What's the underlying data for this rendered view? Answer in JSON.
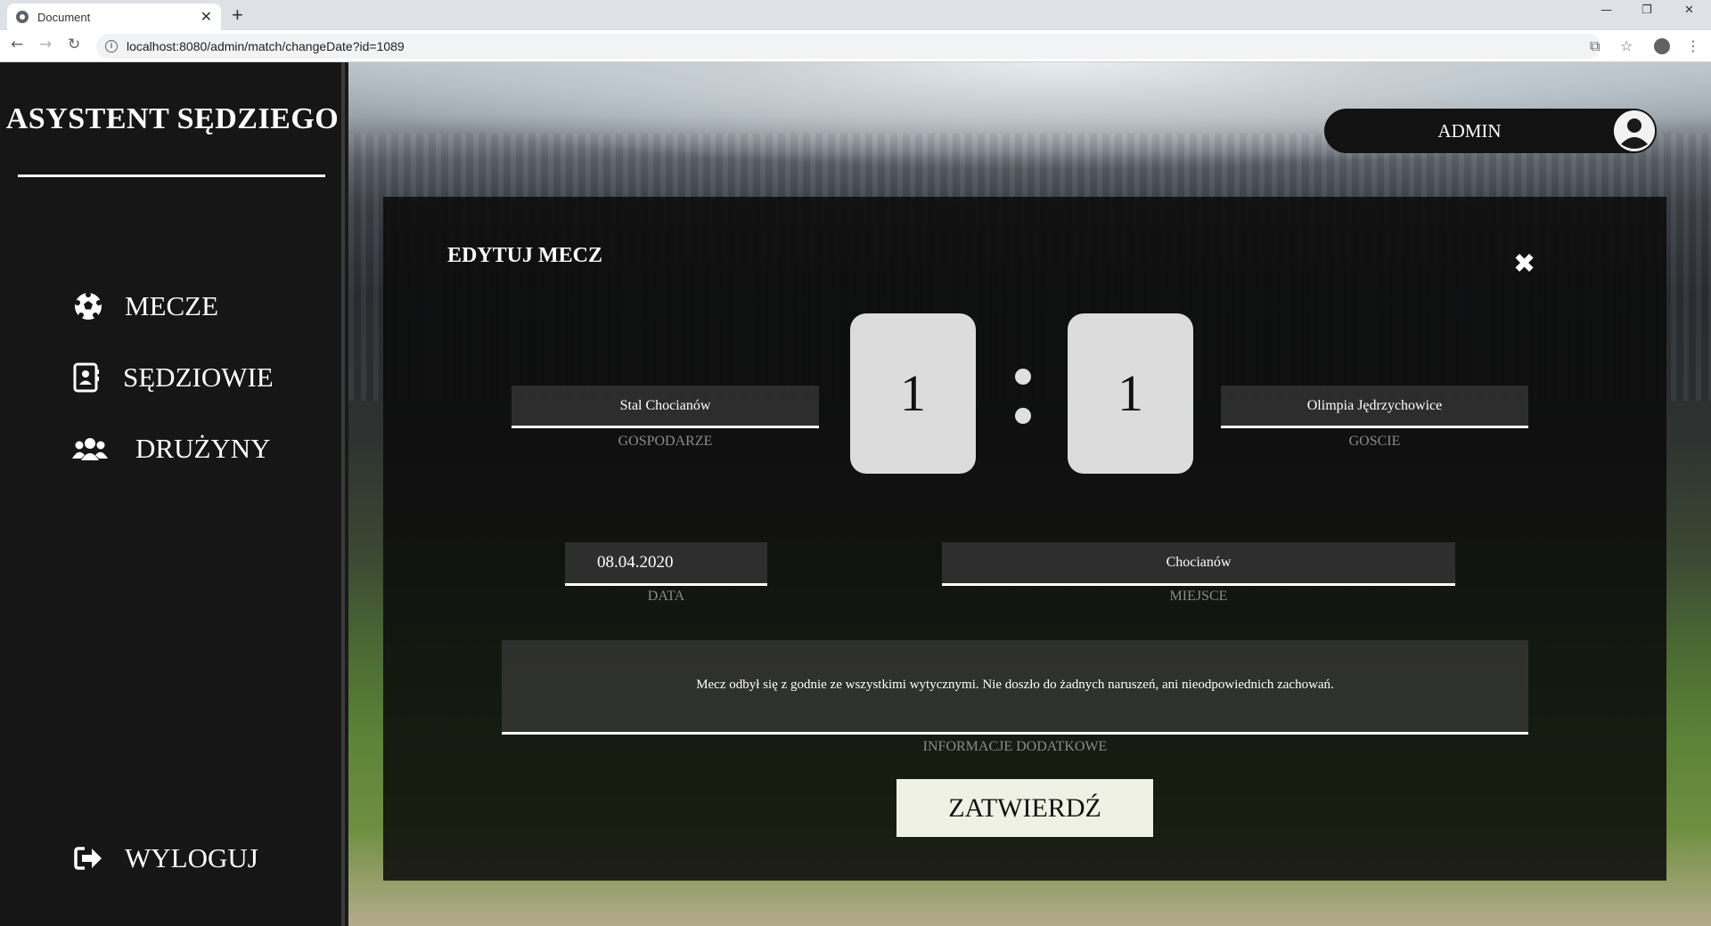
{
  "browser": {
    "tab_title": "Document",
    "tab_close": "✕",
    "new_tab": "+",
    "url": "localhost:8080/admin/match/changeDate?id=1089",
    "window_minimize": "—",
    "window_restore": "❐",
    "window_close": "✕"
  },
  "sidebar": {
    "brand": "ASYSTENT SĘDZIEGO",
    "items": [
      {
        "label": "MECZE",
        "icon": "soccer-ball-icon"
      },
      {
        "label": "SĘDZIOWIE",
        "icon": "contact-card-icon"
      },
      {
        "label": "DRUŻYNY",
        "icon": "users-icon"
      }
    ],
    "logout": {
      "label": "WYLOGUJ",
      "icon": "sign-out-icon"
    }
  },
  "user": {
    "name": "ADMIN",
    "icon": "user-avatar-icon"
  },
  "form": {
    "title": "EDYTUJ MECZ",
    "close": "✖",
    "home_team": "Stal Chocianów",
    "home_label": "GOSPODARZE",
    "away_team": "Olimpia Jędrzychowice",
    "away_label": "GOSCIE",
    "home_score": "1",
    "away_score": "1",
    "date": "08.04.2020",
    "date_label": "DATA",
    "place": "Chocianów",
    "place_label": "MIEJSCE",
    "info": "Mecz odbył się z godnie ze wszystkimi wytycznymi. Nie doszło do żadnych naruszeń, ani nieodpowiednich zachowań.",
    "info_label": "INFORMACJE DODATKOWE",
    "submit": "ZATWIERDŹ"
  }
}
